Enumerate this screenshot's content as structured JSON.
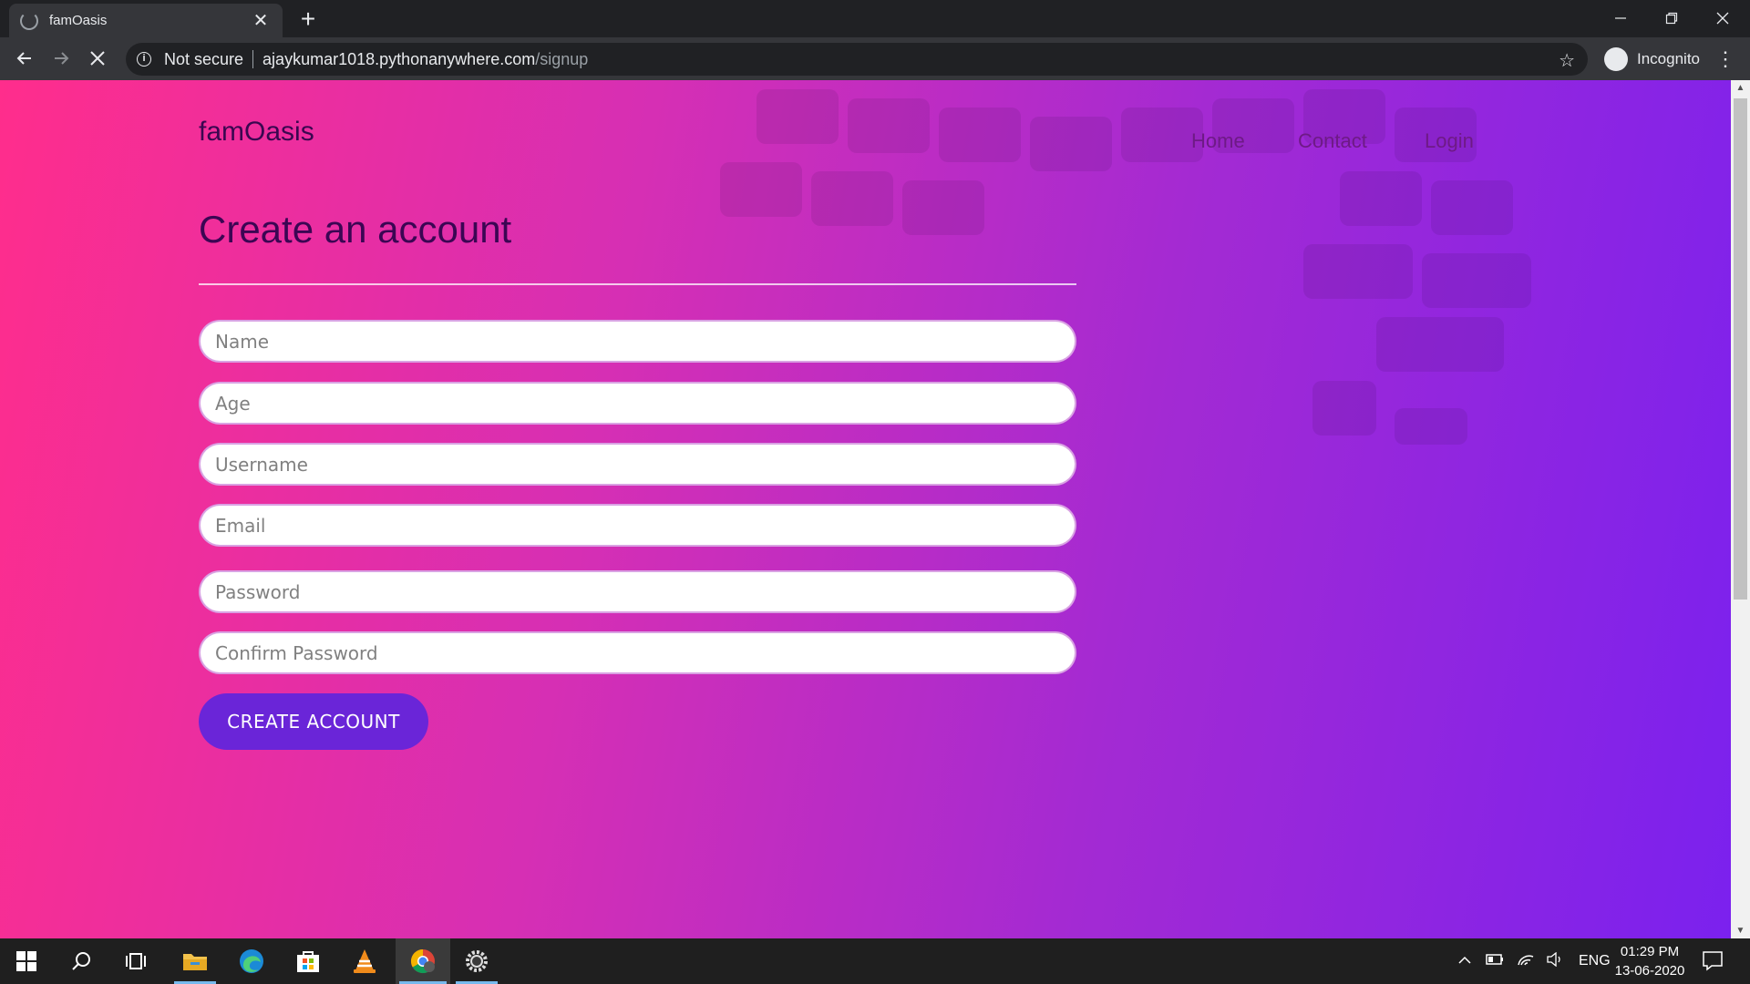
{
  "browser": {
    "tab_title": "famOasis",
    "tab_close": "✕",
    "new_tab": "+",
    "security_label": "Not secure",
    "url_host": "ajaykumar1018.pythonanywhere.com",
    "url_path": "/signup",
    "profile_label": "Incognito"
  },
  "site": {
    "brand": "famOasis",
    "nav": [
      "Home",
      "Contact",
      "Login"
    ],
    "heading": "Create an account",
    "form": {
      "name_placeholder": "Name",
      "age_placeholder": "Age",
      "username_placeholder": "Username",
      "email_placeholder": "Email",
      "password_placeholder": "Password",
      "confirm_placeholder": "Confirm Password",
      "submit_label": "CREATE ACCOUNT"
    }
  },
  "taskbar": {
    "language": "ENG",
    "time": "01:29 PM",
    "date": "13-06-2020"
  },
  "icons": [
    "windows-icon",
    "search-icon",
    "task-view-icon",
    "file-explorer-icon",
    "edge-icon",
    "store-icon",
    "vlc-icon",
    "chrome-icon",
    "settings-app-icon"
  ]
}
